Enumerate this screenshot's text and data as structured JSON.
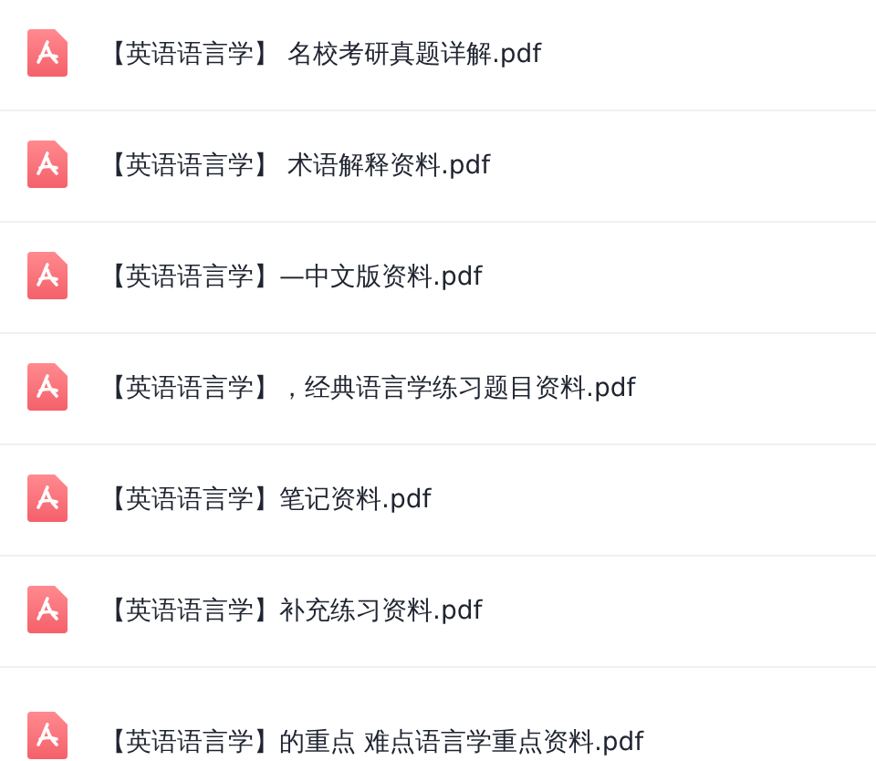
{
  "files": [
    {
      "name": "【英语语言学】 名校考研真题详解.pdf"
    },
    {
      "name": "【英语语言学】 术语解释资料.pdf"
    },
    {
      "name": "【英语语言学】—中文版资料.pdf"
    },
    {
      "name": "【英语语言学】，经典语言学练习题目资料.pdf"
    },
    {
      "name": "【英语语言学】笔记资料.pdf"
    },
    {
      "name": "【英语语言学】补充练习资料.pdf"
    },
    {
      "name": "【英语语言学】的重点 难点语言学重点资料.pdf"
    }
  ]
}
